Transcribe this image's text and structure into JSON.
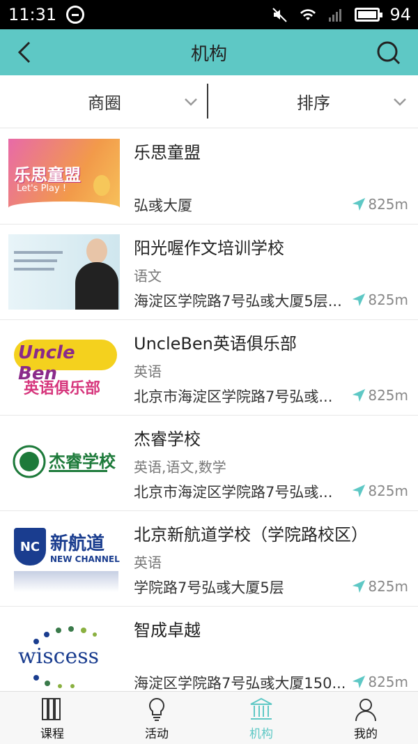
{
  "status_bar": {
    "time": "11:31",
    "battery": "94"
  },
  "header": {
    "title": "机构"
  },
  "filters": {
    "area_label": "商圈",
    "sort_label": "排序"
  },
  "list": [
    {
      "name": "乐思童盟",
      "subjects": "",
      "address": "弘彧大厦",
      "distance": "825m",
      "thumb_text_main": "乐思童盟",
      "thumb_text_sub": "Let's Play !"
    },
    {
      "name": "阳光喔作文培训学校",
      "subjects": "语文",
      "address": "海淀区学院路7号弘彧大厦5层...",
      "distance": "825m"
    },
    {
      "name": "UncleBen英语俱乐部",
      "subjects": "英语",
      "address": "北京市海淀区学院路7号弘彧...",
      "distance": "825m",
      "thumb_text_main": "Uncle Ben",
      "thumb_text_sub": "英语俱乐部"
    },
    {
      "name": "杰睿学校",
      "subjects": "英语,语文,数学",
      "address": "北京市海淀区学院路7号弘彧...",
      "distance": "825m",
      "thumb_text_main": "杰睿学校"
    },
    {
      "name": "北京新航道学校（学院路校区）",
      "subjects": "英语",
      "address": "学院路7号弘彧大厦5层",
      "distance": "825m",
      "thumb_text_main": "新航道",
      "thumb_text_sub": "NEW CHANNEL",
      "thumb_text_logo": "NC"
    },
    {
      "name": "智成卓越",
      "subjects": "",
      "address": "海淀区学院路7号弘彧大厦150...",
      "distance": "825m",
      "thumb_text_main": "wiscess"
    }
  ],
  "tabs": [
    {
      "label": "课程",
      "icon": "books-icon"
    },
    {
      "label": "活动",
      "icon": "lightbulb-icon"
    },
    {
      "label": "机构",
      "icon": "institution-icon",
      "active": true
    },
    {
      "label": "我的",
      "icon": "user-icon"
    }
  ],
  "colors": {
    "accent": "#5ec8c5",
    "nav_arrow": "#5ec8c5"
  }
}
